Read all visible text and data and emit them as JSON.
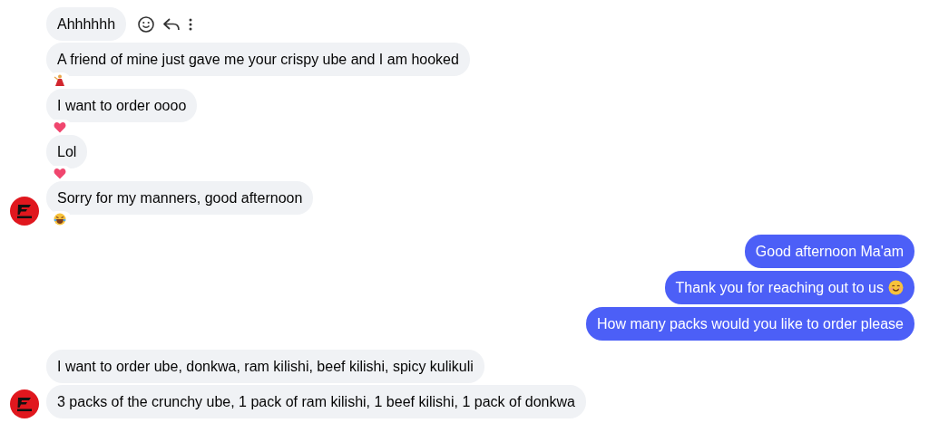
{
  "messages": [
    {
      "kind": "incoming",
      "text": "Ahhhhhh",
      "hover_actions": true,
      "avatar": false
    },
    {
      "kind": "incoming",
      "text": "A friend of mine just gave me your crispy ube and I am hooked",
      "hover_actions": false,
      "reaction": {
        "kind": "dancer"
      },
      "avatar": false
    },
    {
      "kind": "incoming",
      "text": "I want to order oooo",
      "hover_actions": false,
      "reaction": {
        "kind": "heart"
      },
      "avatar": false
    },
    {
      "kind": "incoming",
      "text": "Lol",
      "hover_actions": false,
      "reaction": {
        "kind": "heart"
      },
      "avatar": false
    },
    {
      "kind": "incoming",
      "text": "Sorry for my manners, good afternoon",
      "hover_actions": false,
      "reaction": {
        "kind": "laugh"
      },
      "avatar": true
    },
    {
      "kind": "outgoing",
      "text": "Good afternoon Ma'am",
      "hover_actions": false
    },
    {
      "kind": "outgoing",
      "text": "Thank you for reaching out to us",
      "emoji": {
        "kind": "smile"
      },
      "hover_actions": false
    },
    {
      "kind": "outgoing",
      "text": "How many packs would you like to order please",
      "hover_actions": false
    },
    {
      "kind": "incoming",
      "text": "I want to order ube, donkwa, ram kilishi, beef kilishi, spicy kulikuli",
      "hover_actions": false,
      "avatar": false
    },
    {
      "kind": "incoming",
      "text": "3 packs of the crunchy ube, 1 pack of ram kilishi, 1 beef kilishi, 1 pack of donkwa",
      "hover_actions": false,
      "avatar": true
    }
  ]
}
